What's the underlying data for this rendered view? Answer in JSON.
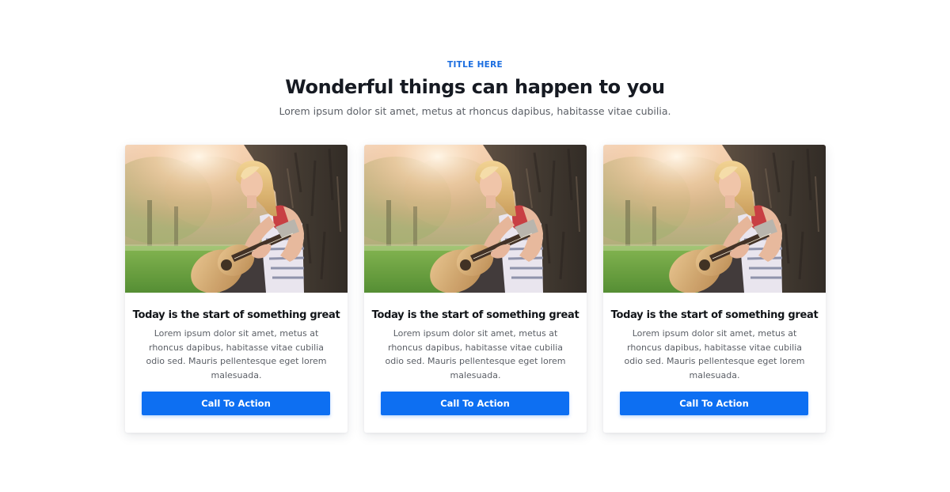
{
  "header": {
    "eyebrow": "TITLE HERE",
    "headline": "Wonderful things can happen to you",
    "subheadline": "Lorem ipsum dolor sit amet, metus at rhoncus dapibus, habitasse vitae cubilia."
  },
  "colors": {
    "accent": "#0d6ff2",
    "eyebrow": "#1a6de0",
    "heading": "#161a22",
    "body_text": "#5b5f66"
  },
  "cards": [
    {
      "image": "woman-playing-guitar-photo",
      "title": "Today is the start of something great",
      "body": "Lorem ipsum dolor sit amet, metus at rhoncus dapibus, habitasse vitae cubilia odio sed. Mauris pellentesque eget lorem malesuada.",
      "cta_label": "Call To Action"
    },
    {
      "image": "woman-playing-guitar-photo",
      "title": "Today is the start of something great",
      "body": "Lorem ipsum dolor sit amet, metus at rhoncus dapibus, habitasse vitae cubilia odio sed. Mauris pellentesque eget lorem malesuada.",
      "cta_label": "Call To Action"
    },
    {
      "image": "woman-playing-guitar-photo",
      "title": "Today is the start of something great",
      "body": "Lorem ipsum dolor sit amet, metus at rhoncus dapibus, habitasse vitae cubilia odio sed. Mauris pellentesque eget lorem malesuada.",
      "cta_label": "Call To Action"
    }
  ]
}
